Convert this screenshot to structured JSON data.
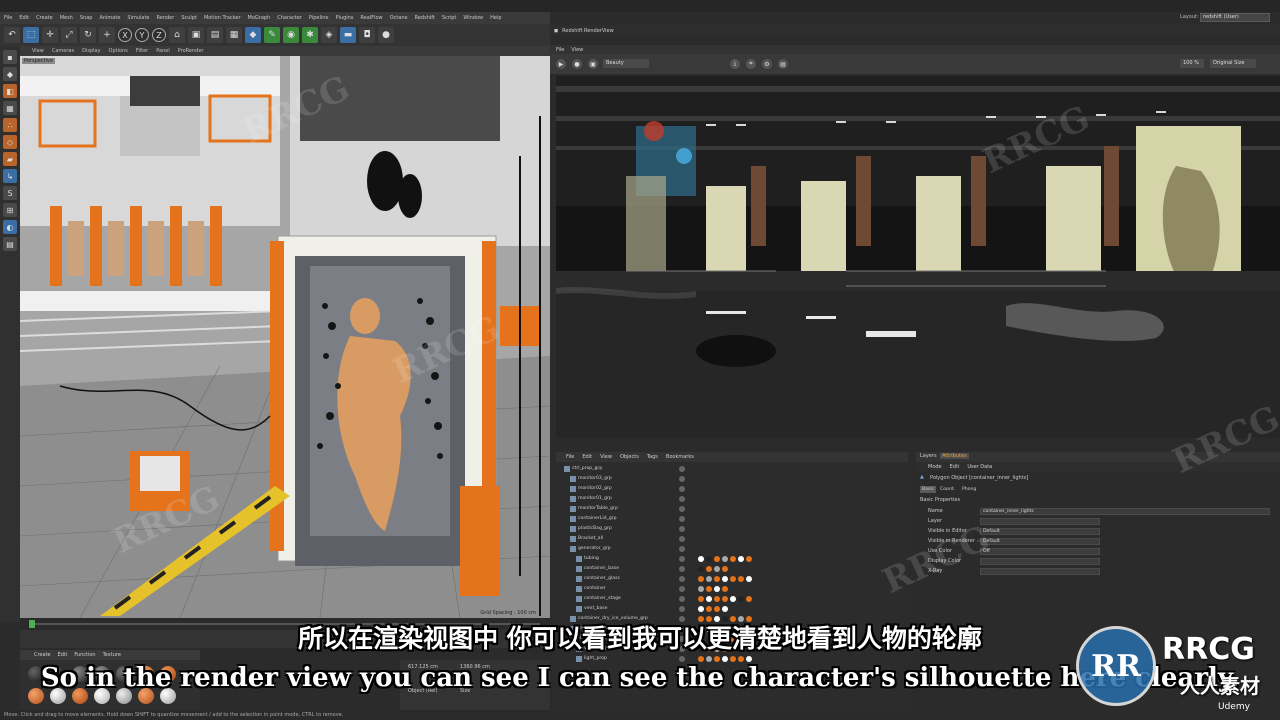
{
  "watermark": "RRCG",
  "menubar": [
    "File",
    "Edit",
    "Create",
    "Mesh",
    "Snap",
    "Animate",
    "Simulate",
    "Render",
    "Sculpt",
    "Motion Tracker",
    "MoGraph",
    "Character",
    "Pipeline",
    "Plugins",
    "RealFlow",
    "Octane",
    "Redshift",
    "Script",
    "Window",
    "Help"
  ],
  "layout": {
    "label": "Layout:",
    "value": "redshift (User)"
  },
  "viewport_menu": [
    "View",
    "Cameras",
    "Display",
    "Options",
    "Filter",
    "Panel",
    "ProRender"
  ],
  "viewport_label": "Perspective",
  "grid_spacing": "Grid Spacing : 100 cm",
  "material_menu": [
    "Create",
    "Edit",
    "Function",
    "Texture"
  ],
  "coords": {
    "x": "617.125 cm",
    "y": "1360.96 cm",
    "mode_a": "Object (Rel)",
    "mode_b": "Size"
  },
  "status": "Move: Click and drag to move elements. Hold down SHIFT to quantize movement / add to the selection in point mode, CTRL to remove.",
  "renderview": {
    "title": "Redshift RenderView",
    "menu": [
      "File",
      "View"
    ],
    "aov": "Beauty",
    "zoom": "100 %",
    "size": "Original Size"
  },
  "object_manager": {
    "menu": [
      "File",
      "Edit",
      "View",
      "Objects",
      "Tags",
      "Bookmarks"
    ],
    "rows": [
      {
        "name": "ctrl_prop_grp",
        "indent": 0
      },
      {
        "name": "monitor03_grp",
        "indent": 1
      },
      {
        "name": "monitor02_grp",
        "indent": 1
      },
      {
        "name": "monitor01_grp",
        "indent": 1
      },
      {
        "name": "monitorTable_grp",
        "indent": 1
      },
      {
        "name": "containerLid_grp",
        "indent": 1
      },
      {
        "name": "plasticBag_grp",
        "indent": 1
      },
      {
        "name": "Bracket_all",
        "indent": 1
      },
      {
        "name": "generator_grp",
        "indent": 1
      },
      {
        "name": "tubing",
        "indent": 2
      },
      {
        "name": "container_base",
        "indent": 2
      },
      {
        "name": "container_glass",
        "indent": 2
      },
      {
        "name": "container",
        "indent": 2
      },
      {
        "name": "container_stage",
        "indent": 2
      },
      {
        "name": "vent_base",
        "indent": 2
      },
      {
        "name": "container_dry_ice_volume_grp",
        "indent": 1
      },
      {
        "name": "Redshift Volume_dry_ice_freezer.1",
        "indent": 1
      },
      {
        "name": "Redshift Volume_dry_ice_volume",
        "indent": 1
      },
      {
        "name": "vent_plugin",
        "indent": 2
      },
      {
        "name": "light_prop",
        "indent": 2
      }
    ]
  },
  "attributes": {
    "tabs": [
      "Layers",
      "Attributes"
    ],
    "menu": [
      "Mode",
      "Edit",
      "User Data"
    ],
    "object": "Polygon Object [container_inner_lights]",
    "subtabs": [
      "Basic",
      "Coord.",
      "Phong"
    ],
    "section": "Basic Properties",
    "fields": [
      {
        "label": "Name",
        "value": "container_inner_lights"
      },
      {
        "label": "Layer",
        "value": ""
      },
      {
        "label": "Visible in Editor",
        "value": "Default"
      },
      {
        "label": "Visible in Renderer",
        "value": "Default"
      },
      {
        "label": "Use Color",
        "value": "Off"
      },
      {
        "label": "Display Color",
        "value": ""
      },
      {
        "label": "X-Ray",
        "value": ""
      }
    ]
  },
  "subtitles": {
    "cn": "所以在渲染视图中 你可以看到我可以更清楚地看到人物的轮廓",
    "en": "So in the render view you can see I can see the character's silhouette here clearly."
  },
  "logo": {
    "mark": "RR",
    "text": "RRCG",
    "cn": "人人素材",
    "udemy": "Udemy"
  }
}
